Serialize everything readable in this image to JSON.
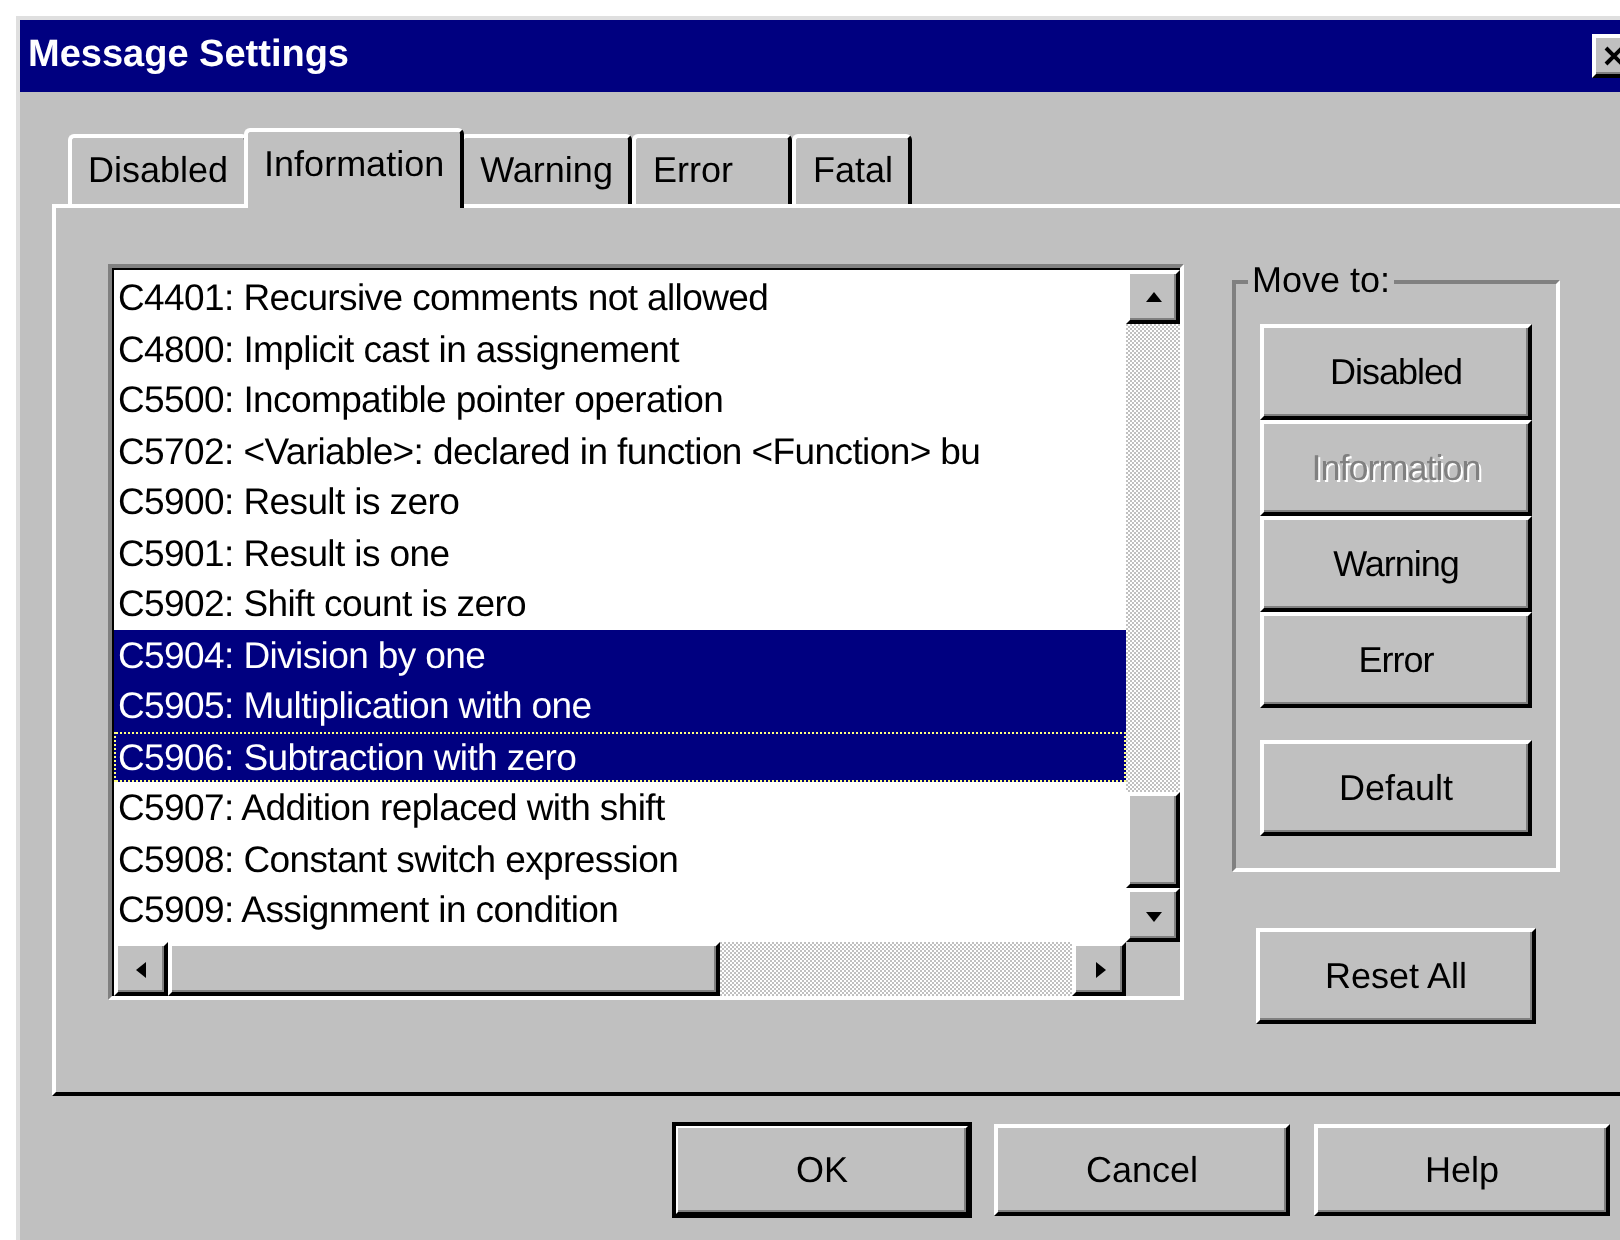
{
  "window": {
    "title": "Message Settings"
  },
  "tabs": [
    {
      "label": "Disabled",
      "selected": false
    },
    {
      "label": "Information",
      "selected": true
    },
    {
      "label": "Warning",
      "selected": false
    },
    {
      "label": "Error",
      "selected": false
    },
    {
      "label": "Fatal",
      "selected": false
    }
  ],
  "messages": [
    {
      "text": "C4401: Recursive comments not allowed",
      "selected": false,
      "focused": false
    },
    {
      "text": "C4800: Implicit cast in assignement",
      "selected": false,
      "focused": false
    },
    {
      "text": "C5500: Incompatible pointer operation",
      "selected": false,
      "focused": false
    },
    {
      "text": "C5702: <Variable>: declared in function <Function> bu",
      "selected": false,
      "focused": false
    },
    {
      "text": "C5900: Result is zero",
      "selected": false,
      "focused": false
    },
    {
      "text": "C5901: Result is one",
      "selected": false,
      "focused": false
    },
    {
      "text": "C5902: Shift count is zero",
      "selected": false,
      "focused": false
    },
    {
      "text": "C5904: Division by one",
      "selected": true,
      "focused": false
    },
    {
      "text": "C5905: Multiplication with one",
      "selected": true,
      "focused": false
    },
    {
      "text": "C5906: Subtraction with zero",
      "selected": true,
      "focused": true
    },
    {
      "text": "C5907: Addition replaced with shift",
      "selected": false,
      "focused": false
    },
    {
      "text": "C5908: Constant switch expression",
      "selected": false,
      "focused": false
    },
    {
      "text": "C5909: Assignment in condition",
      "selected": false,
      "focused": false
    }
  ],
  "move_to": {
    "label": "Move to:",
    "buttons": [
      {
        "label": "Disabled",
        "disabled": false
      },
      {
        "label": "Information",
        "disabled": true
      },
      {
        "label": "Warning",
        "disabled": false
      },
      {
        "label": "Error",
        "disabled": false
      }
    ],
    "default_button": "Default"
  },
  "reset_button": "Reset All",
  "dialog_buttons": [
    {
      "label": "OK",
      "default": true
    },
    {
      "label": "Cancel",
      "default": false
    },
    {
      "label": "Help",
      "default": false
    }
  ]
}
